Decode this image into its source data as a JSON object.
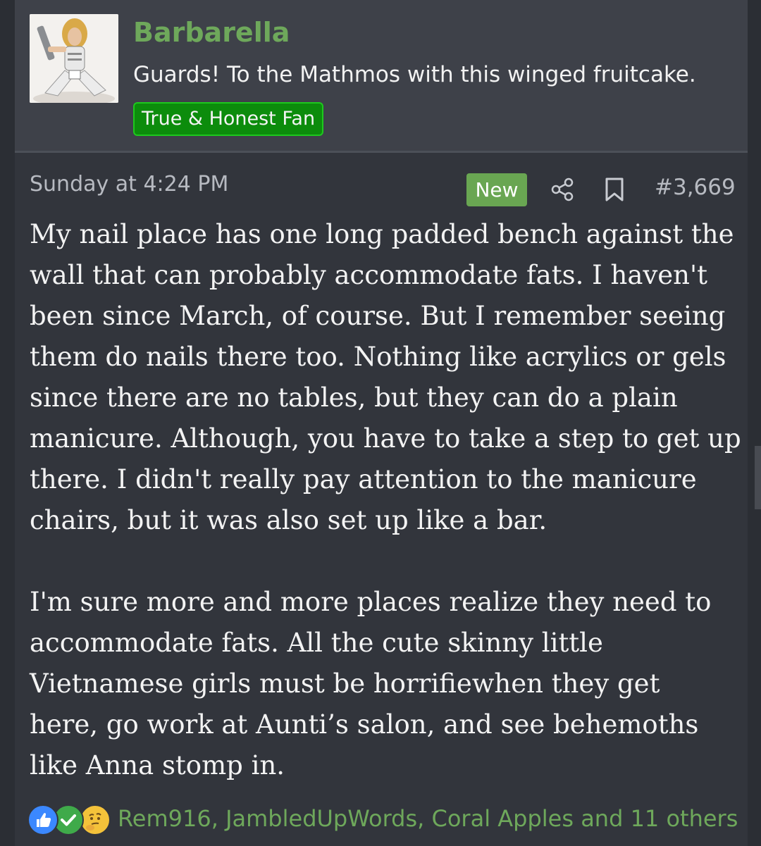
{
  "user": {
    "name": "Barbarella",
    "tagline": "Guards! To the Mathmos with this winged fruitcake.",
    "badge": "True & Honest Fan"
  },
  "post": {
    "timestamp": "Sunday at 4:24 PM",
    "new_label": "New",
    "number": "#3,669",
    "lines": [
      "My nail place has one long padded bench against the",
      "wall that can probably accommodate fats. I haven't",
      "been since March, of course. But I remember seeing",
      "them do nails there too. Nothing like acrylics or gels",
      "since there are no tables, but they can do a plain",
      "manicure. Although, you have to take a step to get up",
      "there. I didn't really pay attention to the manicure",
      "chairs, but it was also set up like a bar.",
      "",
      "I'm sure more and more places realize they need to",
      "accommodate fats. All the cute skinny little",
      "Vietnamese girls must be horrifiewhen they get",
      "here, go work at Aunti’s salon, and see behemoths",
      "like Anna stomp in."
    ]
  },
  "reactions": {
    "icons": [
      "like-icon",
      "agree-icon",
      "thinking-icon"
    ],
    "reactors": "Rem916, JambledUpWords, Coral Apples and 11 others"
  },
  "colors": {
    "username": "#6ea85b",
    "badge_bg": "#0c8c0c",
    "new_badge_bg": "#69a652"
  }
}
